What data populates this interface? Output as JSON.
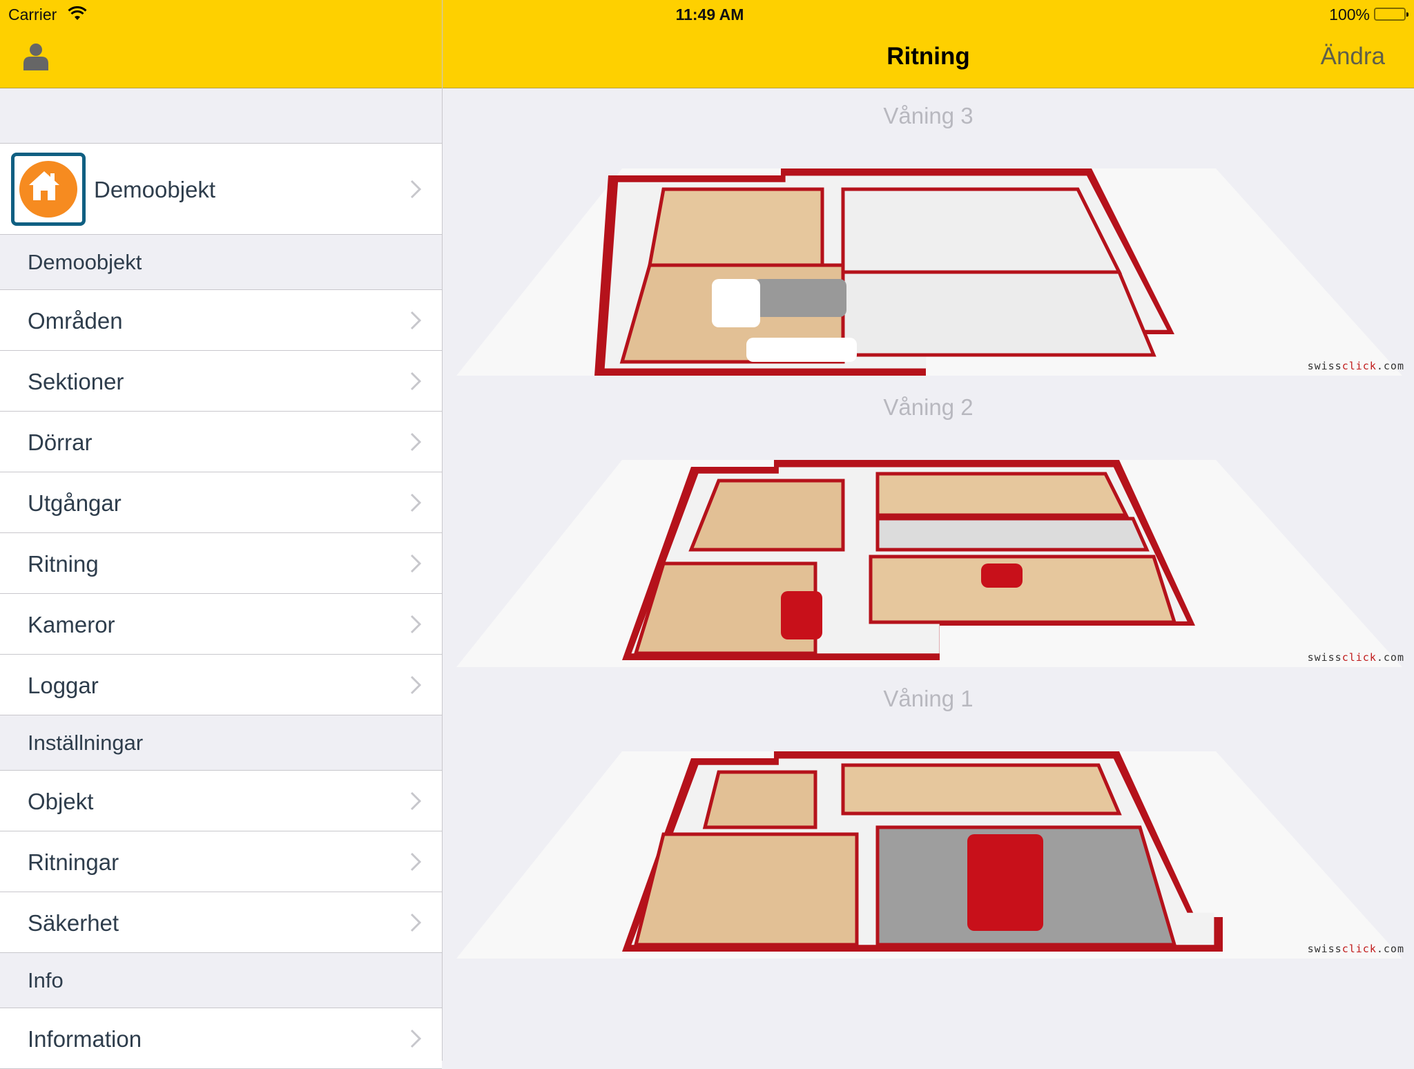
{
  "status_bar": {
    "carrier": "Carrier",
    "time": "11:49 AM",
    "battery_percent": "100%",
    "battery_level": 1.0
  },
  "nav": {
    "title": "Ritning",
    "edit_label": "Ändra",
    "user_icon": "person-icon"
  },
  "colors": {
    "nav_bar": "#fed000",
    "object_icon_bg": "#f68b20",
    "object_icon_border": "#0f5f82",
    "wall_red": "#b5121b"
  },
  "sidebar": {
    "object": {
      "label": "Demoobjekt",
      "icon": "house-icon"
    },
    "sections": [
      {
        "title": "Demoobjekt",
        "items": [
          {
            "label": "Områden"
          },
          {
            "label": "Sektioner"
          },
          {
            "label": "Dörrar"
          },
          {
            "label": "Utgångar"
          },
          {
            "label": "Ritning"
          },
          {
            "label": "Kameror"
          },
          {
            "label": "Loggar"
          }
        ]
      },
      {
        "title": "Inställningar",
        "items": [
          {
            "label": "Objekt"
          },
          {
            "label": "Ritningar"
          },
          {
            "label": "Säkerhet"
          }
        ]
      },
      {
        "title": "Info",
        "items": [
          {
            "label": "Information"
          }
        ]
      }
    ]
  },
  "floors": [
    {
      "label": "Våning 3",
      "watermark_prefix": "swiss",
      "watermark_accent": "click",
      "watermark_suffix": ".com"
    },
    {
      "label": "Våning 2",
      "watermark_prefix": "swiss",
      "watermark_accent": "click",
      "watermark_suffix": ".com"
    },
    {
      "label": "Våning 1",
      "watermark_prefix": "swiss",
      "watermark_accent": "click",
      "watermark_suffix": ".com"
    }
  ]
}
